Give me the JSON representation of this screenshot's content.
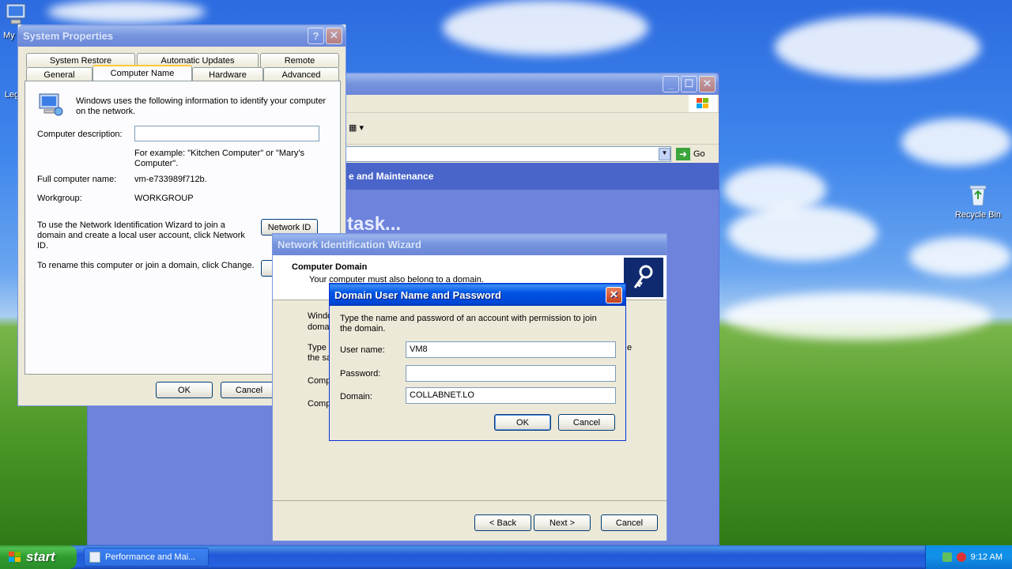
{
  "desktop": {
    "icons": [
      {
        "label": "My"
      },
      {
        "label": "Leg"
      },
      {
        "label": "Recycle Bin"
      }
    ]
  },
  "back_window": {
    "address_go": "Go",
    "category_title": "e and Maintenance",
    "pick_task": "task..."
  },
  "system_properties": {
    "title": "System Properties",
    "help_btn": "?",
    "tabs_row1": [
      "System Restore",
      "Automatic Updates",
      "Remote"
    ],
    "tabs_row2": [
      "General",
      "Computer Name",
      "Hardware",
      "Advanced"
    ],
    "intro": "Windows uses the following information to identify your computer on the network.",
    "desc_label": "Computer description:",
    "desc_value": "",
    "example": "For example: \"Kitchen Computer\" or \"Mary's Computer\".",
    "full_name_label": "Full computer name:",
    "full_name_value": "vm-e733989f712b.",
    "workgroup_label": "Workgroup:",
    "workgroup_value": "WORKGROUP",
    "network_id_text": "To use the Network Identification Wizard to join a domain and create a local user account, click Network ID.",
    "network_id_btn": "Network ID",
    "rename_text": "To rename this computer or join a domain, click Change.",
    "ok": "OK",
    "cancel": "Cancel"
  },
  "wizard": {
    "title": "Network Identification Wizard",
    "heading": "Computer Domain",
    "subheading": "Your computer must also belong to a domain.",
    "frag1": "Windo",
    "frag2": "doma",
    "frag3": "Type",
    "frag4": "the sa",
    "frag5": "Comp",
    "frag6": "Comp",
    "frag7": "e",
    "back": "< Back",
    "next": "Next >",
    "cancel": "Cancel"
  },
  "domain_dialog": {
    "title": "Domain User Name and Password",
    "intro": "Type the name and password of an account with permission to join the domain.",
    "user_label": "User name:",
    "user_value": "VM8",
    "password_label": "Password:",
    "password_value": "",
    "domain_label": "Domain:",
    "domain_value": "COLLABNET.LO",
    "ok": "OK",
    "cancel": "Cancel"
  },
  "taskbar": {
    "start": "start",
    "task_label": "Performance and Mai...",
    "clock": "9:12 AM"
  }
}
